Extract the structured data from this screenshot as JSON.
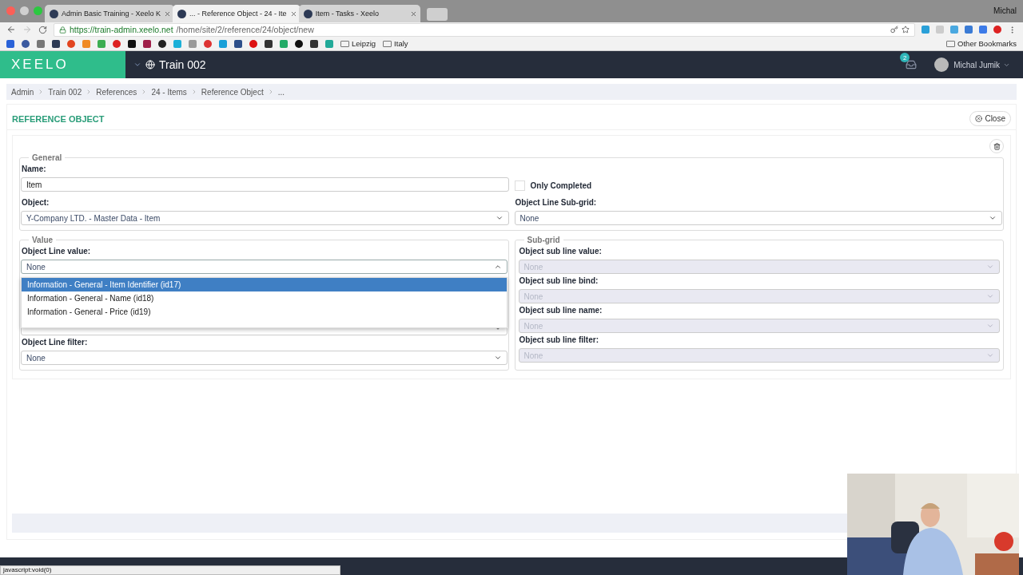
{
  "browser": {
    "tabs": [
      {
        "title": "Admin Basic Training - Xeelo K",
        "selected": false
      },
      {
        "title": "... - Reference Object - 24 - Ite",
        "selected": true
      },
      {
        "title": "Item - Tasks - Xeelo",
        "selected": false
      }
    ],
    "profile": "Michal",
    "url": {
      "host": "https://train-admin.xeelo.net",
      "path": "/home/site/2/reference/24/object/new"
    },
    "bookmarks": [
      {
        "label": "Leipzig"
      },
      {
        "label": "Italy"
      }
    ],
    "other_bookmarks": "Other Bookmarks"
  },
  "app": {
    "logo": "XEELO",
    "site": "Train 002",
    "notifications": "2",
    "user": "Michal Jumik"
  },
  "breadcrumb": [
    "Admin",
    "Train 002",
    "References",
    "24 - Items",
    "Reference Object",
    "..."
  ],
  "page": {
    "title": "REFERENCE OBJECT",
    "close": "Close"
  },
  "general": {
    "legend": "General",
    "name_label": "Name:",
    "name_value": "Item",
    "only_completed": {
      "label": "Only Completed",
      "checked": false
    },
    "object_label": "Object:",
    "object_value": "Y-Company LTD. - Master Data - Item",
    "subgrid_label": "Object Line Sub-grid:",
    "subgrid_value": "None"
  },
  "value": {
    "legend": "Value",
    "fields": [
      {
        "kind": "select",
        "label": "Object Line value:",
        "value": "None",
        "open": true,
        "options": [
          {
            "label": "Information - General - Item Identifier (id17)",
            "selected": true
          },
          {
            "label": "Information - General - Name (id18)",
            "selected": false
          },
          {
            "label": "Information - General - Price (id19)",
            "selected": false
          }
        ]
      },
      {
        "kind": "covered"
      },
      {
        "kind": "select",
        "label": "Object Line filter:",
        "value": "None",
        "open": false
      }
    ]
  },
  "subgrid": {
    "legend": "Sub-grid",
    "fields": [
      {
        "label": "Object sub line value:",
        "placeholder": "None",
        "disabled": true
      },
      {
        "label": "Object sub line bind:",
        "placeholder": "None",
        "disabled": true
      },
      {
        "label": "Object sub line name:",
        "placeholder": "None",
        "disabled": true
      },
      {
        "label": "Object sub line filter:",
        "placeholder": "None",
        "disabled": true
      }
    ]
  },
  "status_bar": "javascript:void(0)"
}
